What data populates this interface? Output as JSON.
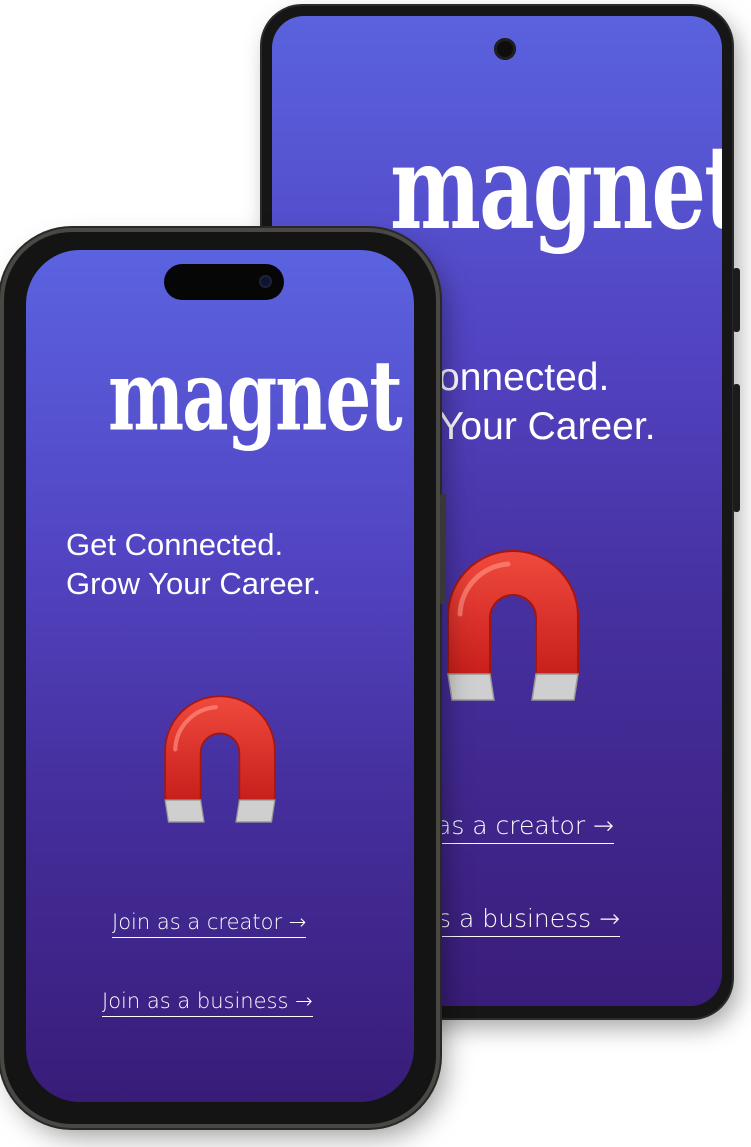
{
  "app": {
    "logo_text": "magnet",
    "tagline_line1": "Get Connected.",
    "tagline_line2": "Grow Your Career.",
    "creator_link": "Join as a creator →",
    "business_link": "Join as a business →",
    "magnet_icon": "horseshoe-magnet-icon"
  },
  "back_phone": {
    "tagline_line1_visible": "onnected.",
    "tagline_line2_visible": "Your Career.",
    "creator_link_visible": "as a creator →",
    "business_link_visible": "s a business →"
  },
  "colors": {
    "gradient_top": "#5b63e0",
    "gradient_bottom": "#381c78",
    "magnet_red": "#e8312c",
    "magnet_tip": "#c8c8c8",
    "text": "#ffffff"
  }
}
